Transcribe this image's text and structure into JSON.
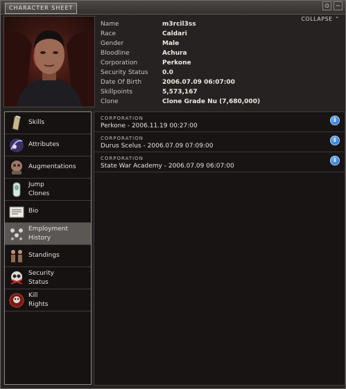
{
  "window": {
    "title": "CHARACTER SHEET",
    "collapse_label": "COLLAPSE",
    "collapse_glyph": "⌃",
    "min_glyph": "⊙",
    "close_glyph": "−"
  },
  "character": {
    "fields": [
      {
        "label": "Name",
        "value": "m3rcil3ss"
      },
      {
        "label": "Race",
        "value": "Caldari"
      },
      {
        "label": "Gender",
        "value": "Male"
      },
      {
        "label": "Bloodline",
        "value": "Achura"
      },
      {
        "label": "Corporation",
        "value": "Perkone"
      },
      {
        "label": "Security Status",
        "value": "0.0"
      },
      {
        "label": "Date Of Birth",
        "value": "2006.07.09 06:07:00"
      },
      {
        "label": "Skillpoints",
        "value": "5,573,167"
      },
      {
        "label": "Clone",
        "value": "Clone Grade Nu (7,680,000)"
      }
    ]
  },
  "nav": {
    "items": [
      {
        "label": "Skills",
        "icon": "skills-icon"
      },
      {
        "label": "Attributes",
        "icon": "attributes-icon"
      },
      {
        "label": "Augmentations",
        "icon": "augmentations-icon"
      },
      {
        "label": "Jump\nClones",
        "icon": "jump-clones-icon"
      },
      {
        "label": "Bio",
        "icon": "bio-icon"
      },
      {
        "label": "Employment\nHistory",
        "icon": "employment-history-icon"
      },
      {
        "label": "Standings",
        "icon": "standings-icon"
      },
      {
        "label": "Security\nStatus",
        "icon": "security-status-icon"
      },
      {
        "label": "Kill\nRights",
        "icon": "kill-rights-icon"
      }
    ],
    "active_index": 5
  },
  "history": {
    "header": "CORPORATION",
    "info_glyph": "i",
    "entries": [
      {
        "line": "Perkone - 2006.11.19 00:27:00"
      },
      {
        "line": "Durus Scelus - 2006.07.09 07:09:00"
      },
      {
        "line": "State War Academy - 2006.07.09 06:07:00"
      }
    ]
  },
  "colors": {
    "panel_bg": "#171413",
    "active_nav": "#5a5754",
    "info_blue": "#1a5fc2"
  }
}
